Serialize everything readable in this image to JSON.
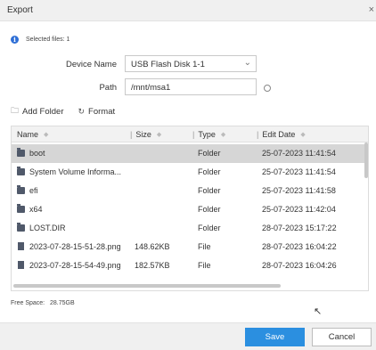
{
  "window": {
    "title": "Export",
    "close_glyph": "×"
  },
  "info": {
    "icon": "info-icon",
    "text": "Selected files: 1",
    "accent": "#2f6fd6"
  },
  "form": {
    "device_label": "Device Name",
    "device_value": "USB Flash Disk 1-1",
    "path_label": "Path",
    "path_value": "/mnt/msa1"
  },
  "toolbar": {
    "add_folder_label": "Add Folder",
    "format_label": "Format"
  },
  "table": {
    "columns": [
      "Name",
      "Size",
      "Type",
      "Edit Date"
    ],
    "rows": [
      {
        "name": "boot",
        "size": "",
        "type": "Folder",
        "date": "25-07-2023 11:41:54",
        "icon": "folder-icon",
        "selected": true
      },
      {
        "name": "System Volume Informa...",
        "size": "",
        "type": "Folder",
        "date": "25-07-2023 11:41:54",
        "icon": "folder-icon",
        "selected": false
      },
      {
        "name": "efi",
        "size": "",
        "type": "Folder",
        "date": "25-07-2023 11:41:58",
        "icon": "folder-icon",
        "selected": false
      },
      {
        "name": "x64",
        "size": "",
        "type": "Folder",
        "date": "25-07-2023 11:42:04",
        "icon": "folder-icon",
        "selected": false
      },
      {
        "name": "LOST.DIR",
        "size": "",
        "type": "Folder",
        "date": "28-07-2023 15:17:22",
        "icon": "folder-icon",
        "selected": false
      },
      {
        "name": "2023-07-28-15-51-28.png",
        "size": "148.62KB",
        "type": "File",
        "date": "28-07-2023 16:04:22",
        "icon": "file-icon",
        "selected": false
      },
      {
        "name": "2023-07-28-15-54-49.png",
        "size": "182.57KB",
        "type": "File",
        "date": "28-07-2023 16:04:26",
        "icon": "file-icon",
        "selected": false
      }
    ]
  },
  "status": {
    "free_space_label": "Free Space:",
    "free_space_value": "28.75GB"
  },
  "buttons": {
    "save_label": "Save",
    "cancel_label": "Cancel",
    "save_color": "#2b8fe0"
  }
}
